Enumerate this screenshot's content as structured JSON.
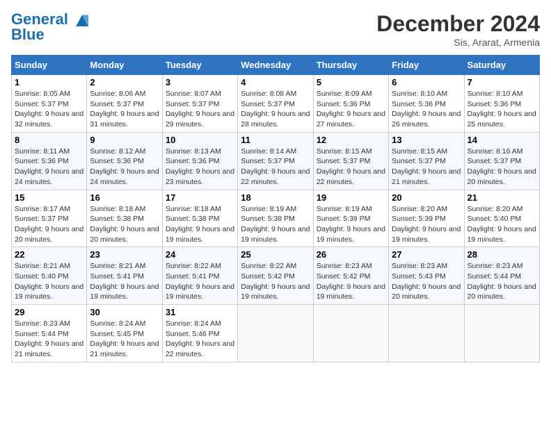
{
  "header": {
    "logo_line1": "General",
    "logo_line2": "Blue",
    "month": "December 2024",
    "location": "Sis, Ararat, Armenia"
  },
  "days_of_week": [
    "Sunday",
    "Monday",
    "Tuesday",
    "Wednesday",
    "Thursday",
    "Friday",
    "Saturday"
  ],
  "weeks": [
    [
      {
        "day": "1",
        "sunrise": "8:05 AM",
        "sunset": "5:37 PM",
        "daylight": "9 hours and 32 minutes."
      },
      {
        "day": "2",
        "sunrise": "8:06 AM",
        "sunset": "5:37 PM",
        "daylight": "9 hours and 31 minutes."
      },
      {
        "day": "3",
        "sunrise": "8:07 AM",
        "sunset": "5:37 PM",
        "daylight": "9 hours and 29 minutes."
      },
      {
        "day": "4",
        "sunrise": "8:08 AM",
        "sunset": "5:37 PM",
        "daylight": "9 hours and 28 minutes."
      },
      {
        "day": "5",
        "sunrise": "8:09 AM",
        "sunset": "5:36 PM",
        "daylight": "9 hours and 27 minutes."
      },
      {
        "day": "6",
        "sunrise": "8:10 AM",
        "sunset": "5:36 PM",
        "daylight": "9 hours and 26 minutes."
      },
      {
        "day": "7",
        "sunrise": "8:10 AM",
        "sunset": "5:36 PM",
        "daylight": "9 hours and 25 minutes."
      }
    ],
    [
      {
        "day": "8",
        "sunrise": "8:11 AM",
        "sunset": "5:36 PM",
        "daylight": "9 hours and 24 minutes."
      },
      {
        "day": "9",
        "sunrise": "8:12 AM",
        "sunset": "5:36 PM",
        "daylight": "9 hours and 24 minutes."
      },
      {
        "day": "10",
        "sunrise": "8:13 AM",
        "sunset": "5:36 PM",
        "daylight": "9 hours and 23 minutes."
      },
      {
        "day": "11",
        "sunrise": "8:14 AM",
        "sunset": "5:37 PM",
        "daylight": "9 hours and 22 minutes."
      },
      {
        "day": "12",
        "sunrise": "8:15 AM",
        "sunset": "5:37 PM",
        "daylight": "9 hours and 22 minutes."
      },
      {
        "day": "13",
        "sunrise": "8:15 AM",
        "sunset": "5:37 PM",
        "daylight": "9 hours and 21 minutes."
      },
      {
        "day": "14",
        "sunrise": "8:16 AM",
        "sunset": "5:37 PM",
        "daylight": "9 hours and 20 minutes."
      }
    ],
    [
      {
        "day": "15",
        "sunrise": "8:17 AM",
        "sunset": "5:37 PM",
        "daylight": "9 hours and 20 minutes."
      },
      {
        "day": "16",
        "sunrise": "8:18 AM",
        "sunset": "5:38 PM",
        "daylight": "9 hours and 20 minutes."
      },
      {
        "day": "17",
        "sunrise": "8:18 AM",
        "sunset": "5:38 PM",
        "daylight": "9 hours and 19 minutes."
      },
      {
        "day": "18",
        "sunrise": "8:19 AM",
        "sunset": "5:38 PM",
        "daylight": "9 hours and 19 minutes."
      },
      {
        "day": "19",
        "sunrise": "8:19 AM",
        "sunset": "5:39 PM",
        "daylight": "9 hours and 19 minutes."
      },
      {
        "day": "20",
        "sunrise": "8:20 AM",
        "sunset": "5:39 PM",
        "daylight": "9 hours and 19 minutes."
      },
      {
        "day": "21",
        "sunrise": "8:20 AM",
        "sunset": "5:40 PM",
        "daylight": "9 hours and 19 minutes."
      }
    ],
    [
      {
        "day": "22",
        "sunrise": "8:21 AM",
        "sunset": "5:40 PM",
        "daylight": "9 hours and 19 minutes."
      },
      {
        "day": "23",
        "sunrise": "8:21 AM",
        "sunset": "5:41 PM",
        "daylight": "9 hours and 19 minutes."
      },
      {
        "day": "24",
        "sunrise": "8:22 AM",
        "sunset": "5:41 PM",
        "daylight": "9 hours and 19 minutes."
      },
      {
        "day": "25",
        "sunrise": "8:22 AM",
        "sunset": "5:42 PM",
        "daylight": "9 hours and 19 minutes."
      },
      {
        "day": "26",
        "sunrise": "8:23 AM",
        "sunset": "5:42 PM",
        "daylight": "9 hours and 19 minutes."
      },
      {
        "day": "27",
        "sunrise": "8:23 AM",
        "sunset": "5:43 PM",
        "daylight": "9 hours and 20 minutes."
      },
      {
        "day": "28",
        "sunrise": "8:23 AM",
        "sunset": "5:44 PM",
        "daylight": "9 hours and 20 minutes."
      }
    ],
    [
      {
        "day": "29",
        "sunrise": "8:23 AM",
        "sunset": "5:44 PM",
        "daylight": "9 hours and 21 minutes."
      },
      {
        "day": "30",
        "sunrise": "8:24 AM",
        "sunset": "5:45 PM",
        "daylight": "9 hours and 21 minutes."
      },
      {
        "day": "31",
        "sunrise": "8:24 AM",
        "sunset": "5:46 PM",
        "daylight": "9 hours and 22 minutes."
      },
      null,
      null,
      null,
      null
    ]
  ]
}
